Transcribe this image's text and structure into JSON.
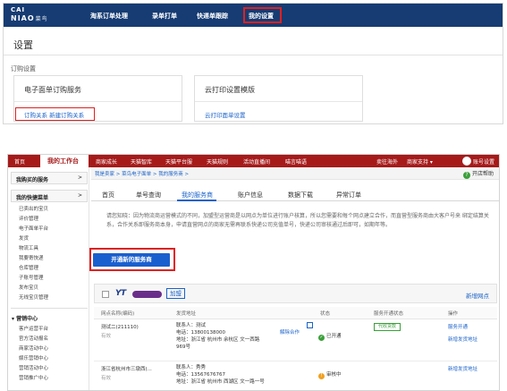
{
  "top": {
    "logo_line1": "CAI",
    "logo_line2": "NIAO",
    "logo_cn": "菜鸟",
    "nav": [
      "淘系订单处理",
      "录单打单",
      "快递单跟踪",
      "我的设置"
    ],
    "title": "设置",
    "section_label": "订购设置",
    "cards": [
      {
        "title": "电子面单订购服务",
        "link": "订购关系  新建订购关系"
      },
      {
        "title": "云打印设置模版",
        "link": "云打印面单设置"
      }
    ]
  },
  "bottom": {
    "nav": {
      "home": "首页",
      "active": "我的工作台",
      "items": [
        "商家成长",
        "天猫智库",
        "天猫平台服",
        "天猫规则",
        "活动直播间",
        "喵言喵语"
      ],
      "right_items": [
        "卖往海外",
        "商家支持 ▾"
      ],
      "account": "账号设置"
    },
    "sidebar": {
      "head1": "我购买的服务",
      "head2": "我的快捷菜单",
      "items": [
        "已卖出的宝贝",
        "评价管理",
        "电子面单平台",
        "发货",
        "物流工具",
        "我要寄快递",
        "仓库管理",
        "子账号管理",
        "发布宝贝",
        "无线宝贝管理"
      ],
      "group": "营销中心",
      "group_items": [
        "客户运营平台",
        "官方活动报名",
        "商家活动中心",
        "娱乐营销中心",
        "营销活动中心",
        "营销推广中心"
      ]
    },
    "breadcrumb": "我是卖家 > 菜鸟电子面单 > 我的服务商 >",
    "help": "开店帮助",
    "tabs": [
      "首页",
      "单号查询",
      "我的服务商",
      "账户信息",
      "数据下载",
      "异常订单"
    ],
    "notice": "请您知晓：因为物流商运营模式的不同，加盟型运营商是以网点为单位进行账户核算，所以您需要和每个网点建立合作，而直营型服务商由大客户号来 绑定结算关系，合作关系即服务商本身，申请直营网点的商家无需再联系快递公司充值单号，快递公司审核通过后即可，如期年等。",
    "open_button": "开通新的服务商",
    "provider": {
      "logo_text": "YT",
      "tag": "加盟",
      "add_branch": "新增网点"
    },
    "columns": [
      "网点名称(编码)",
      "发货地址",
      "状态",
      "服务开通状态",
      "操作"
    ],
    "rows": [
      {
        "name": "测试二(211110)",
        "sub": "有效",
        "contact": "联系人：测试",
        "phone": "电话：13800138000",
        "addr": "地址：浙江省 杭州市 余杭区 文一西路",
        "addr2": "969号",
        "addr_action": "解除合作",
        "status": "已开通",
        "service_tag": "代收货款",
        "ops": [
          "服务开通",
          "新增发货地址"
        ]
      },
      {
        "name": "浙江省杭州市三墩西(...",
        "sub": "有效",
        "contact": "联系人：秀秀",
        "phone": "电话：13567676767",
        "addr": "地址：浙江省 杭州市 西湖区 文一路一号",
        "status": "审核中",
        "ops": [
          "新增发货地址"
        ]
      }
    ]
  },
  "colors": {
    "top_nav_bg": "#163c73",
    "bottom_nav_bg": "#a61a1a",
    "link": "#1a62c9",
    "highlight": "#e02020",
    "primary_button": "#1a5fce",
    "success": "#3aa03a",
    "pending": "#f0a020"
  },
  "icons": [
    "help-circle-icon",
    "user-circle-icon",
    "edit-icon",
    "check-circle-icon",
    "clock-icon",
    "yto-logo-icon"
  ]
}
